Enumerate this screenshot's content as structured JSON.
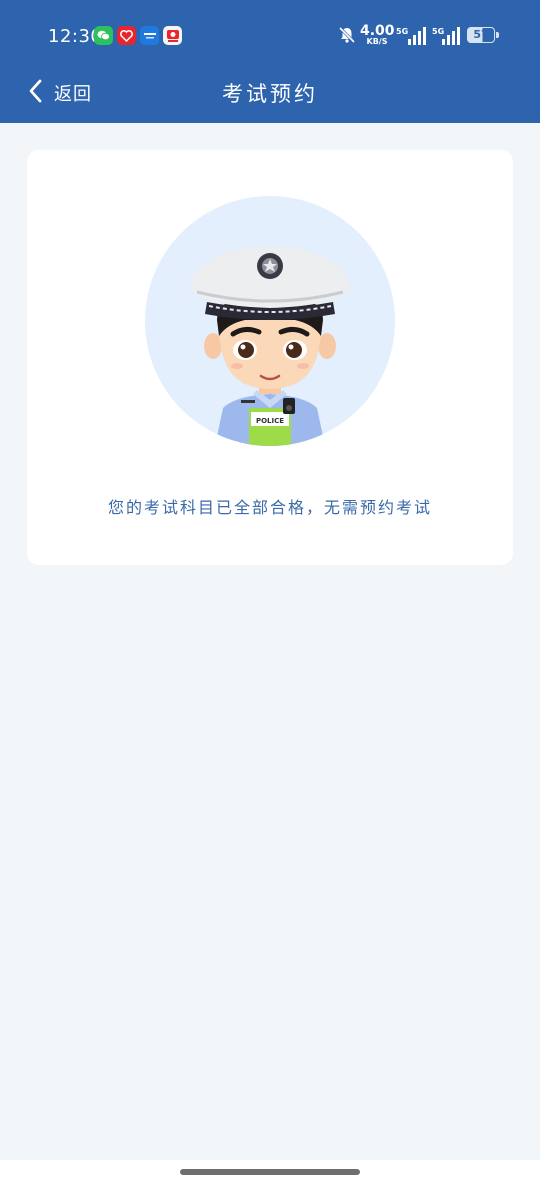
{
  "status_bar": {
    "time": "12:30",
    "net_speed_value": "4.00",
    "net_speed_unit": "KB/S",
    "signal_1_label": "5G",
    "signal_2_label": "5G",
    "battery_level": "57",
    "app_icons": [
      "wechat-icon",
      "app-red-icon",
      "app-blue-icon",
      "app-red-white-icon"
    ]
  },
  "nav": {
    "back_label": "返回",
    "title": "考试预约"
  },
  "card": {
    "illustration": "police-officer-avatar",
    "police_badge_text": "POLICE",
    "message": "您的考试科目已全部合格，无需预约考试"
  },
  "colors": {
    "header_bg": "#2d64ad",
    "page_bg": "#f3f6f8",
    "card_bg": "#ffffff",
    "message_text": "#3a6aa8",
    "avatar_circle": "#e3effd"
  }
}
